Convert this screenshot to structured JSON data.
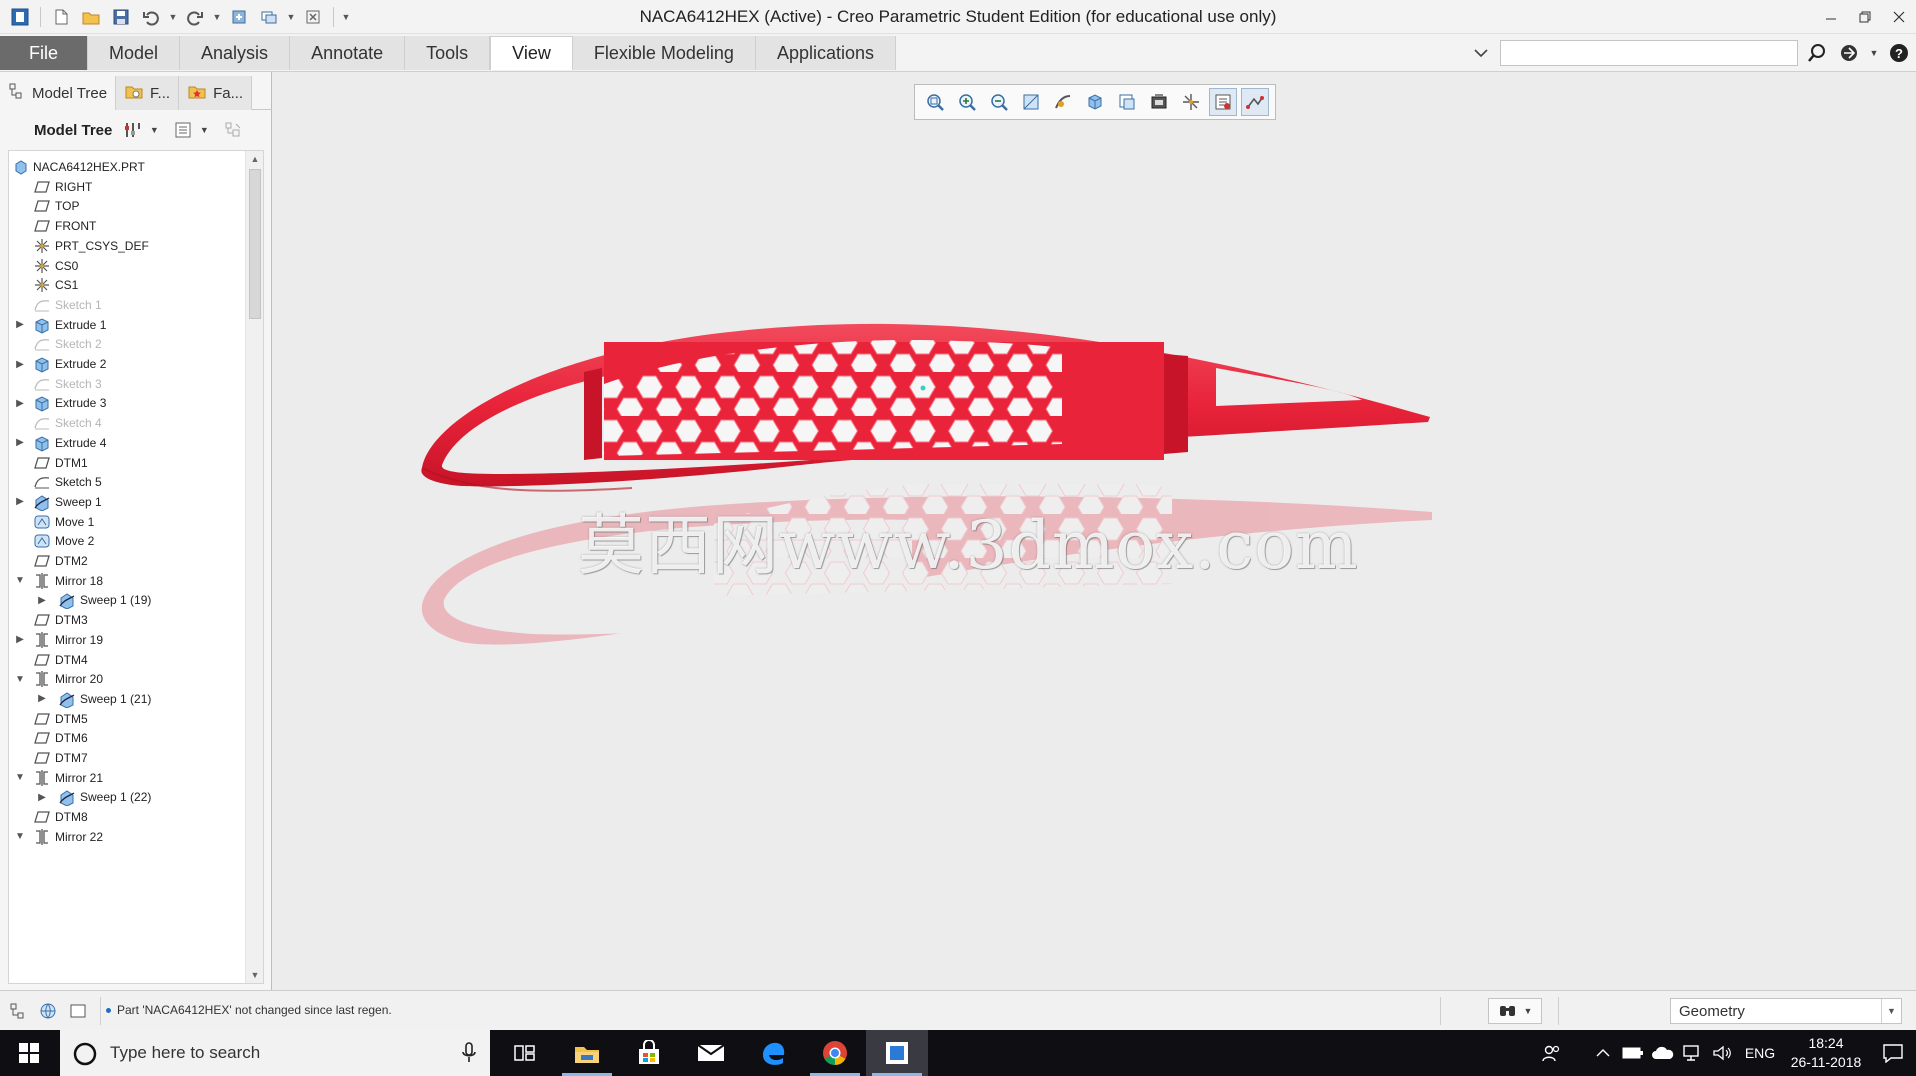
{
  "window": {
    "title": "NACA6412HEX (Active) - Creo Parametric Student Edition (for educational use only)"
  },
  "ribbon": {
    "tabs": [
      {
        "label": "File"
      },
      {
        "label": "Model"
      },
      {
        "label": "Analysis"
      },
      {
        "label": "Annotate"
      },
      {
        "label": "Tools"
      },
      {
        "label": "View"
      },
      {
        "label": "Flexible Modeling"
      },
      {
        "label": "Applications"
      }
    ],
    "active_tab": "View",
    "search_value": ""
  },
  "left_panel": {
    "tabs": [
      {
        "label": "Model Tree"
      },
      {
        "label": "F..."
      },
      {
        "label": "Fa..."
      }
    ],
    "toolbar_label": "Model Tree",
    "tree": [
      {
        "label": "NACA6412HEX.PRT",
        "level": 0,
        "icon": "part-icon",
        "expander": "none",
        "state": "normal"
      },
      {
        "label": "RIGHT",
        "level": 1,
        "icon": "datum-plane-icon",
        "expander": "none",
        "state": "normal"
      },
      {
        "label": "TOP",
        "level": 1,
        "icon": "datum-plane-icon",
        "expander": "none",
        "state": "normal"
      },
      {
        "label": "FRONT",
        "level": 1,
        "icon": "datum-plane-icon",
        "expander": "none",
        "state": "normal"
      },
      {
        "label": "PRT_CSYS_DEF",
        "level": 1,
        "icon": "csys-icon",
        "expander": "none",
        "state": "normal"
      },
      {
        "label": "CS0",
        "level": 1,
        "icon": "csys-icon",
        "expander": "none",
        "state": "normal"
      },
      {
        "label": "CS1",
        "level": 1,
        "icon": "csys-icon",
        "expander": "none",
        "state": "normal"
      },
      {
        "label": "Sketch 1",
        "level": 1,
        "icon": "sketch-icon",
        "expander": "none",
        "state": "suppressed"
      },
      {
        "label": "Extrude 1",
        "level": 1,
        "icon": "extrude-icon",
        "expander": "collapsed",
        "state": "normal"
      },
      {
        "label": "Sketch 2",
        "level": 1,
        "icon": "sketch-icon",
        "expander": "none",
        "state": "suppressed"
      },
      {
        "label": "Extrude 2",
        "level": 1,
        "icon": "extrude-icon",
        "expander": "collapsed",
        "state": "normal"
      },
      {
        "label": "Sketch 3",
        "level": 1,
        "icon": "sketch-icon",
        "expander": "none",
        "state": "suppressed"
      },
      {
        "label": "Extrude 3",
        "level": 1,
        "icon": "extrude-icon",
        "expander": "collapsed",
        "state": "normal"
      },
      {
        "label": "Sketch 4",
        "level": 1,
        "icon": "sketch-icon",
        "expander": "none",
        "state": "suppressed"
      },
      {
        "label": "Extrude 4",
        "level": 1,
        "icon": "extrude-icon",
        "expander": "collapsed",
        "state": "normal"
      },
      {
        "label": "DTM1",
        "level": 1,
        "icon": "datum-plane-icon",
        "expander": "none",
        "state": "normal"
      },
      {
        "label": "Sketch 5",
        "level": 1,
        "icon": "sketch-icon",
        "expander": "none",
        "state": "normal"
      },
      {
        "label": "Sweep 1",
        "level": 1,
        "icon": "sweep-icon",
        "expander": "collapsed",
        "state": "normal"
      },
      {
        "label": "Move 1",
        "level": 1,
        "icon": "move-icon",
        "expander": "none",
        "state": "normal"
      },
      {
        "label": "Move 2",
        "level": 1,
        "icon": "move-icon",
        "expander": "none",
        "state": "normal"
      },
      {
        "label": "DTM2",
        "level": 1,
        "icon": "datum-plane-icon",
        "expander": "none",
        "state": "normal"
      },
      {
        "label": "Mirror 18",
        "level": 1,
        "icon": "mirror-icon",
        "expander": "expanded",
        "state": "normal"
      },
      {
        "label": "Sweep 1 (19)",
        "level": 2,
        "icon": "sweep-icon",
        "expander": "collapsed",
        "state": "normal"
      },
      {
        "label": "DTM3",
        "level": 1,
        "icon": "datum-plane-icon",
        "expander": "none",
        "state": "normal"
      },
      {
        "label": "Mirror 19",
        "level": 1,
        "icon": "mirror-icon",
        "expander": "collapsed",
        "state": "normal"
      },
      {
        "label": "DTM4",
        "level": 1,
        "icon": "datum-plane-icon",
        "expander": "none",
        "state": "normal"
      },
      {
        "label": "Mirror 20",
        "level": 1,
        "icon": "mirror-icon",
        "expander": "expanded",
        "state": "normal"
      },
      {
        "label": "Sweep 1 (21)",
        "level": 2,
        "icon": "sweep-icon",
        "expander": "collapsed",
        "state": "normal"
      },
      {
        "label": "DTM5",
        "level": 1,
        "icon": "datum-plane-icon",
        "expander": "none",
        "state": "normal"
      },
      {
        "label": "DTM6",
        "level": 1,
        "icon": "datum-plane-icon",
        "expander": "none",
        "state": "normal"
      },
      {
        "label": "DTM7",
        "level": 1,
        "icon": "datum-plane-icon",
        "expander": "none",
        "state": "normal"
      },
      {
        "label": "Mirror 21",
        "level": 1,
        "icon": "mirror-icon",
        "expander": "expanded",
        "state": "normal"
      },
      {
        "label": "Sweep 1 (22)",
        "level": 2,
        "icon": "sweep-icon",
        "expander": "collapsed",
        "state": "normal"
      },
      {
        "label": "DTM8",
        "level": 1,
        "icon": "datum-plane-icon",
        "expander": "none",
        "state": "normal"
      },
      {
        "label": "Mirror 22",
        "level": 1,
        "icon": "mirror-icon",
        "expander": "expanded",
        "state": "normal"
      }
    ]
  },
  "graphics": {
    "toolbar_icons": [
      "refit-icon",
      "zoom-in-icon",
      "zoom-out-icon",
      "repaint-icon",
      "spin-center-icon",
      "view-manager-icon",
      "saved-orientations-icon",
      "display-style-icon",
      "datum-display-icon",
      "annotation-display-icon",
      "sketch-display-icon"
    ],
    "watermark": "莫西网www.3dmox.com",
    "model_color": "#e8233a"
  },
  "status": {
    "message": "Part 'NACA6412HEX' not changed since last regen.",
    "filter_value": "Geometry"
  },
  "taskbar": {
    "search_placeholder": "Type here to search",
    "language": "ENG",
    "time": "18:24",
    "date": "26-11-2018"
  }
}
